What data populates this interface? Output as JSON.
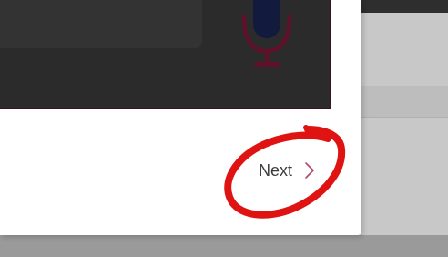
{
  "dialog": {
    "next_label": "Next"
  },
  "icons": {
    "microphone": "microphone-icon",
    "next_chevron": "chevron-right-icon"
  },
  "colors": {
    "dialog_background": "#ffffff",
    "preview_background": "#2b2b2b",
    "preview_border": "#3a1322",
    "microphone_head": "#121a3d",
    "microphone_stand": "#5e1128",
    "next_text": "#3c3c3c",
    "next_chevron": "#b5456d",
    "annotation_circle": "#e01313",
    "overlay_dim": "#9a9a9a"
  }
}
